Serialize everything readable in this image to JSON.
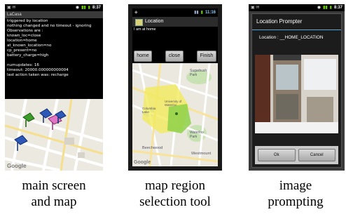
{
  "phones": {
    "main": {
      "status_time": "8:37",
      "app_title": "LaCasa",
      "log_lines": [
        "triggered by location",
        "nothing changed and no timeout - ignoring",
        "Observations are :",
        "  known_loc=close",
        "  location=home",
        "  at_known_location=no",
        "  cp_present=no",
        "  battery_charge=high",
        "",
        "numupdates: 16",
        "timeout: 20000.000000000004",
        "last action taken was: recharge"
      ],
      "map_watermark": "Google"
    },
    "region_tool": {
      "status_time": "11:16",
      "app_title": "Location",
      "status_line": "I am at home",
      "buttons": {
        "home": "home",
        "close": "close",
        "finish": "Finish"
      },
      "map_labels": {
        "sugarhush": "Sugarbush Park",
        "columbia": "Columbia Lake",
        "waterloo": "Waterloo Park",
        "beechwood": "Beechwood",
        "westmount": "Westmount",
        "university": "University of Waterloo",
        "google": "Google"
      }
    },
    "prompter": {
      "status_time": "8:37",
      "dialog_title": "Location Prompter",
      "location_text": "Location : __HOME_LOCATION",
      "buttons": {
        "ok": "Ok",
        "cancel": "Cancel"
      }
    }
  },
  "captions": {
    "main": [
      "main screen",
      "and map"
    ],
    "region_tool": [
      "map region",
      "selection tool"
    ],
    "prompter": [
      "image",
      "prompting"
    ]
  },
  "colors": {
    "selection_yellow": "#f2ea5a",
    "selection_green": "#8ed14a",
    "park_green": "#c9e2b3",
    "road_yellow": "#f7e39b",
    "dialog_accent": "#5aa7d6"
  }
}
